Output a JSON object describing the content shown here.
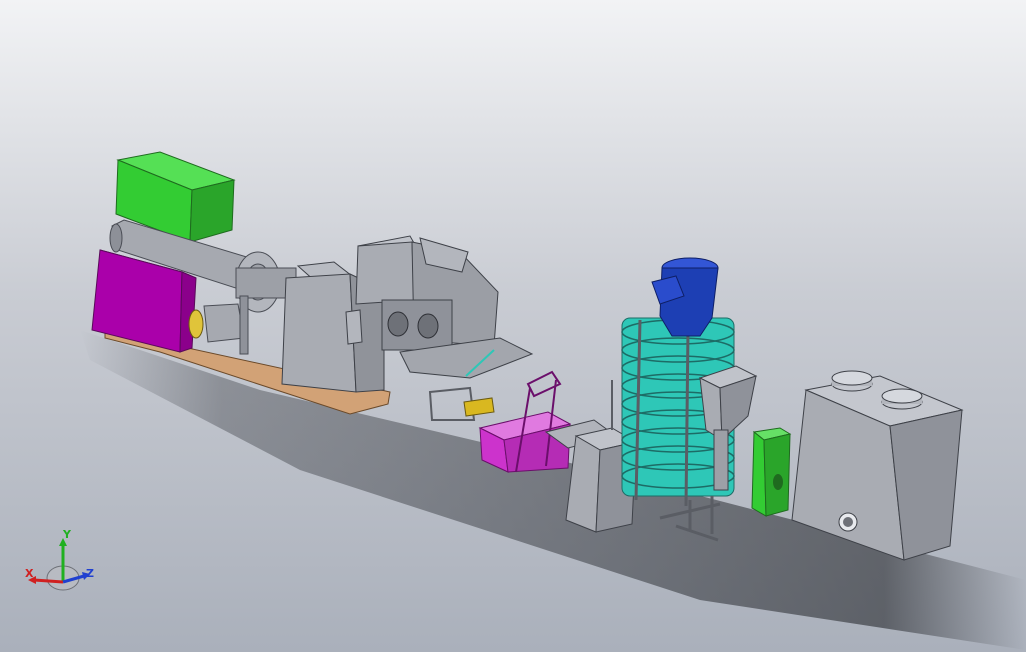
{
  "colors": {
    "background_top": "#f2f3f5",
    "background_bottom": "#aab0bb",
    "motor_green": "#33cc33",
    "panel_magenta": "#aa00aa",
    "hopper_magenta": "#cc33cc",
    "machine_gray": "#a9acb3",
    "base_wood": "#d2a276",
    "cyclone_teal": "#2ec7b7",
    "hopper_blue": "#1d3fb4",
    "axis_x": "#d02020",
    "axis_y": "#20b020",
    "axis_z": "#2040d0"
  },
  "triad": {
    "x_label": "X",
    "y_label": "Y",
    "z_label": "Z"
  }
}
